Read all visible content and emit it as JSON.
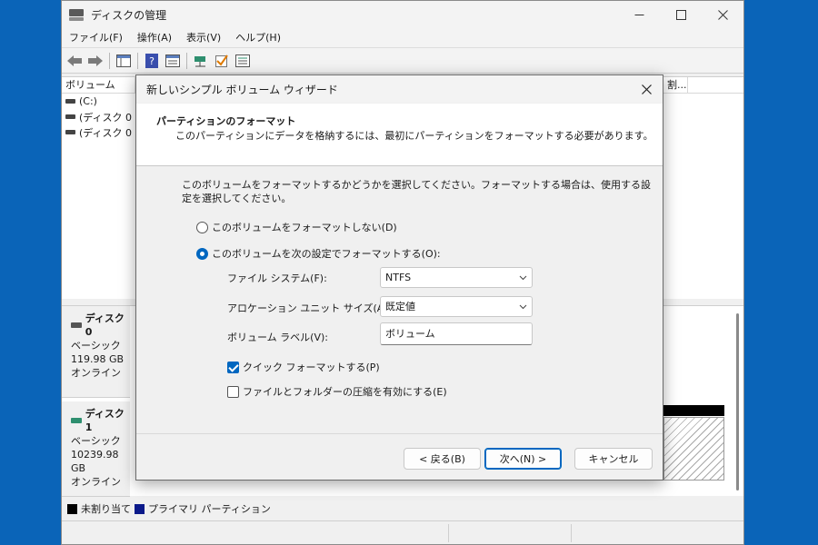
{
  "main_window": {
    "title": "ディスクの管理",
    "controls": {
      "minimize": "—",
      "maximize": "☐",
      "close": "✕"
    },
    "menu": [
      "ファイル(F)",
      "操作(A)",
      "表示(V)",
      "ヘルプ(H)"
    ],
    "toolbar_icons": [
      "back-arrow-icon",
      "forward-arrow-icon",
      "console-tree-icon",
      "help-icon",
      "properties-icon",
      "connect-icon",
      "check-icon",
      "list-icon"
    ],
    "volume_list": {
      "columns": [
        "ボリューム",
        "割..."
      ],
      "rows": [
        "(C:)",
        "(ディスク 0 パ",
        "(ディスク 0 パ"
      ]
    },
    "disks": [
      {
        "name": "ディスク 0",
        "type": "ベーシック",
        "size": "119.98 GB",
        "status": "オンライン"
      },
      {
        "name": "ディスク 1",
        "type": "ベーシック",
        "size": "10239.98 GB",
        "status": "オンライン"
      }
    ],
    "legend": {
      "unallocated": "未割り当て",
      "primary": "プライマリ パーティション"
    }
  },
  "wizard": {
    "title": "新しいシンプル ボリューム ウィザード",
    "close": "✕",
    "header_title": "パーティションのフォーマット",
    "header_sub": "このパーティションにデータを格納するには、最初にパーティションをフォーマットする必要があります。",
    "instruction": "このボリュームをフォーマットするかどうかを選択してください。フォーマットする場合は、使用する設定を選択してください。",
    "radio_no_format": "このボリュームをフォーマットしない(D)",
    "radio_format": "このボリュームを次の設定でフォーマットする(O):",
    "radio_selected": "format",
    "fs_label": "ファイル システム(F):",
    "fs_value": "NTFS",
    "alloc_label": "アロケーション ユニット サイズ(A):",
    "alloc_value": "既定値",
    "vol_label_label": "ボリューム ラベル(V):",
    "vol_label_value": "ボリューム",
    "quick_format": "クイック フォーマットする(P)",
    "quick_format_checked": true,
    "compression": "ファイルとフォルダーの圧縮を有効にする(E)",
    "compression_checked": false,
    "btn_back": "< 戻る(B)",
    "btn_next": "次へ(N) >",
    "btn_cancel": "キャンセル"
  },
  "colors": {
    "desktop": "#0a64b8",
    "accent": "#0067c0",
    "legend_primary": "#0b1a8a"
  }
}
